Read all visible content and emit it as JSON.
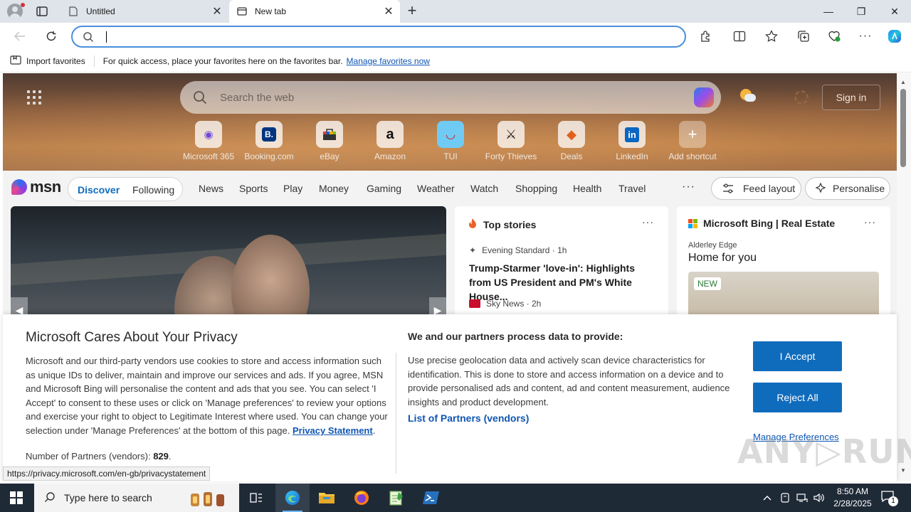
{
  "tabs": [
    {
      "title": "Untitled"
    },
    {
      "title": "New tab"
    }
  ],
  "address_bar": {
    "value": "",
    "placeholder": ""
  },
  "favorites_bar": {
    "import_label": "Import favorites",
    "message": "For quick access, place your favorites here on the favorites bar.",
    "manage_link": "Manage favorites now"
  },
  "msn": {
    "search_placeholder": "Search the web",
    "sign_in": "Sign in",
    "shortcuts": [
      {
        "label": "Microsoft 365",
        "icon": "microsoft-365-icon",
        "glyph": "◉"
      },
      {
        "label": "Booking.com",
        "icon": "booking-icon",
        "glyph": "B."
      },
      {
        "label": "eBay",
        "icon": "ebay-icon",
        "glyph": "▣"
      },
      {
        "label": "Amazon",
        "icon": "amazon-icon",
        "glyph": "a"
      },
      {
        "label": "TUI",
        "icon": "tui-icon",
        "glyph": "◡"
      },
      {
        "label": "Forty Thieves",
        "icon": "forty-thieves-icon",
        "glyph": "✕"
      },
      {
        "label": "Deals",
        "icon": "deals-icon",
        "glyph": "◆"
      },
      {
        "label": "LinkedIn",
        "icon": "linkedin-icon",
        "glyph": "in"
      },
      {
        "label": "Add shortcut",
        "icon": "plus-icon",
        "glyph": "+"
      }
    ],
    "logo_text": "msn",
    "discover": "Discover",
    "following": "Following",
    "nav_items": [
      "News",
      "Sports",
      "Play",
      "Money",
      "Gaming",
      "Weather",
      "Watch",
      "Shopping",
      "Health",
      "Travel"
    ],
    "feed_layout": "Feed layout",
    "personalise": "Personalise"
  },
  "top_stories": {
    "heading": "Top stories",
    "items": [
      {
        "source": "Evening Standard · 1h",
        "title": "Trump-Starmer 'love-in': Highlights from US President and PM's White House..."
      },
      {
        "source": "Sky News · 2h"
      }
    ]
  },
  "bing_card": {
    "heading": "Microsoft Bing | Real Estate",
    "location": "Alderley Edge",
    "title": "Home for you",
    "badge": "NEW"
  },
  "consent": {
    "title": "Microsoft Cares About Your Privacy",
    "body": "Microsoft and our third-party vendors use cookies to store and access information such as unique IDs to deliver, maintain and improve our services and ads. If you agree, MSN and Microsoft Bing will personalise the content and ads that you see. You can select 'I Accept' to consent to these uses or click on 'Manage preferences' to review your options and exercise your right to object to Legitimate Interest where used.  You can change your selection under 'Manage Preferences' at the bottom of this page.",
    "privacy_link": "Privacy Statement",
    "partners_label": "Number of Partners (vendors):",
    "partners_count": "829",
    "heading2": "We and our partners process data to provide:",
    "body2": "Use precise geolocation data and actively scan device characteristics for identification. This is done to store and access information on a device and to provide personalised ads and content, ad and content measurement, audience insights and product development.",
    "vendors_link": "List of Partners (vendors)",
    "accept": "I Accept",
    "reject": "Reject All",
    "manage": "Manage Preferences"
  },
  "status_url": "https://privacy.microsoft.com/en-gb/privacystatement",
  "watermark": "ANY.RUN",
  "taskbar": {
    "search_placeholder": "Type here to search",
    "time": "8:50 AM",
    "date": "2/28/2025",
    "notification_count": "1"
  },
  "colors": {
    "accent": "#0f6cbd",
    "link": "#0f56b3",
    "address_border": "#4a8fd9",
    "taskbar": "#1f2a37"
  }
}
